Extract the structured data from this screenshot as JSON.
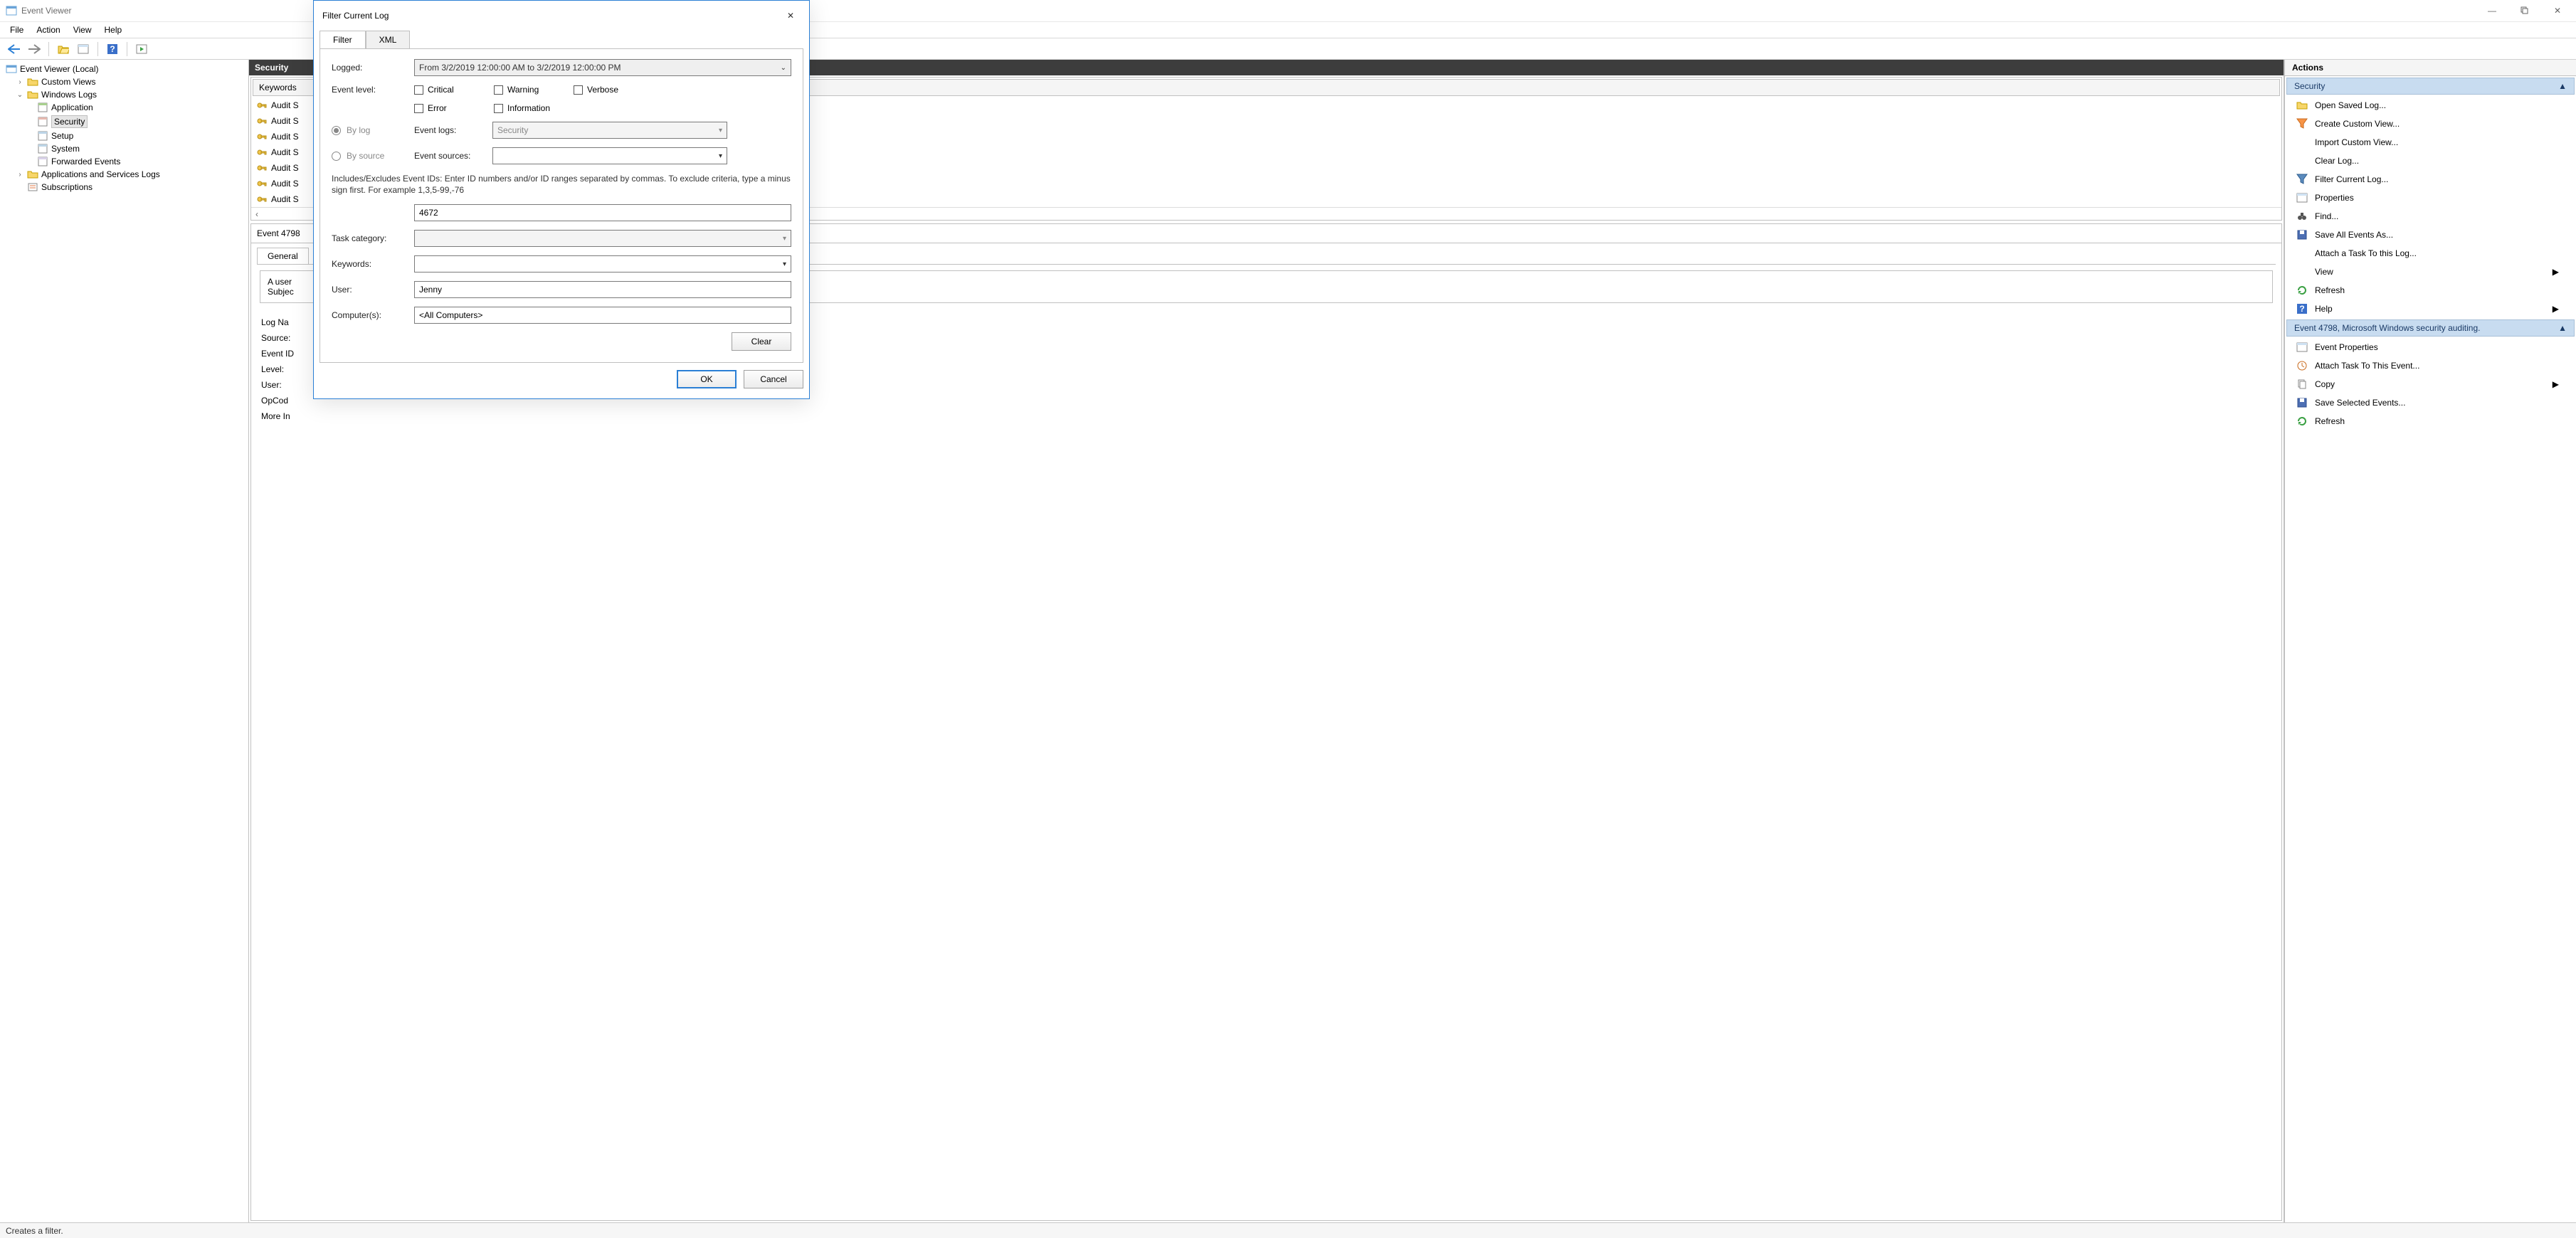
{
  "window": {
    "title": "Event Viewer"
  },
  "menu": {
    "file": "File",
    "action": "Action",
    "view": "View",
    "help": "Help"
  },
  "tree": {
    "root": "Event Viewer (Local)",
    "custom_views": "Custom Views",
    "windows_logs": "Windows Logs",
    "application": "Application",
    "security": "Security",
    "setup": "Setup",
    "system": "System",
    "forwarded": "Forwarded Events",
    "apps_services": "Applications and Services Logs",
    "subscriptions": "Subscriptions"
  },
  "center": {
    "title": "Security",
    "col_keywords": "Keywords",
    "rows": [
      "Audit S",
      "Audit S",
      "Audit S",
      "Audit S",
      "Audit S",
      "Audit S",
      "Audit S"
    ],
    "detail_title": "Event 4798",
    "tab_general": "General",
    "msg1": "A user",
    "msg2": "Subjec",
    "f_logname": "Log Na",
    "f_source": "Source:",
    "f_eventid": "Event ID",
    "f_level": "Level:",
    "f_user": "User:",
    "f_opcode": "OpCod",
    "f_moreinfo": "More In"
  },
  "actions": {
    "panel": "Actions",
    "group1": "Security",
    "open_saved": "Open Saved Log...",
    "create_custom": "Create Custom View...",
    "import_custom": "Import Custom View...",
    "clear_log": "Clear Log...",
    "filter_current": "Filter Current Log...",
    "properties": "Properties",
    "find": "Find...",
    "save_all": "Save All Events As...",
    "attach_task_log": "Attach a Task To this Log...",
    "view": "View",
    "refresh": "Refresh",
    "help": "Help",
    "group2": "Event 4798, Microsoft Windows security auditing.",
    "event_props": "Event Properties",
    "attach_task_event": "Attach Task To This Event...",
    "copy": "Copy",
    "save_selected": "Save Selected Events...",
    "refresh2": "Refresh"
  },
  "dialog": {
    "title": "Filter Current Log",
    "tab_filter": "Filter",
    "tab_xml": "XML",
    "logged": "Logged:",
    "logged_value": "From 3/2/2019 12:00:00 AM to 3/2/2019 12:00:00 PM",
    "event_level": "Event level:",
    "critical": "Critical",
    "warning": "Warning",
    "verbose": "Verbose",
    "error": "Error",
    "information": "Information",
    "by_log": "By log",
    "by_source": "By source",
    "event_logs": "Event logs:",
    "event_logs_value": "Security",
    "event_sources": "Event sources:",
    "desc": "Includes/Excludes Event IDs: Enter ID numbers and/or ID ranges separated by commas. To exclude criteria, type a minus sign first. For example 1,3,5-99,-76",
    "event_ids": "4672",
    "task_category": "Task category:",
    "keywords": "Keywords:",
    "user": "User:",
    "user_value": "Jenny",
    "computers": "Computer(s):",
    "computers_value": "<All Computers>",
    "clear": "Clear",
    "ok": "OK",
    "cancel": "Cancel"
  },
  "status": "Creates a filter."
}
